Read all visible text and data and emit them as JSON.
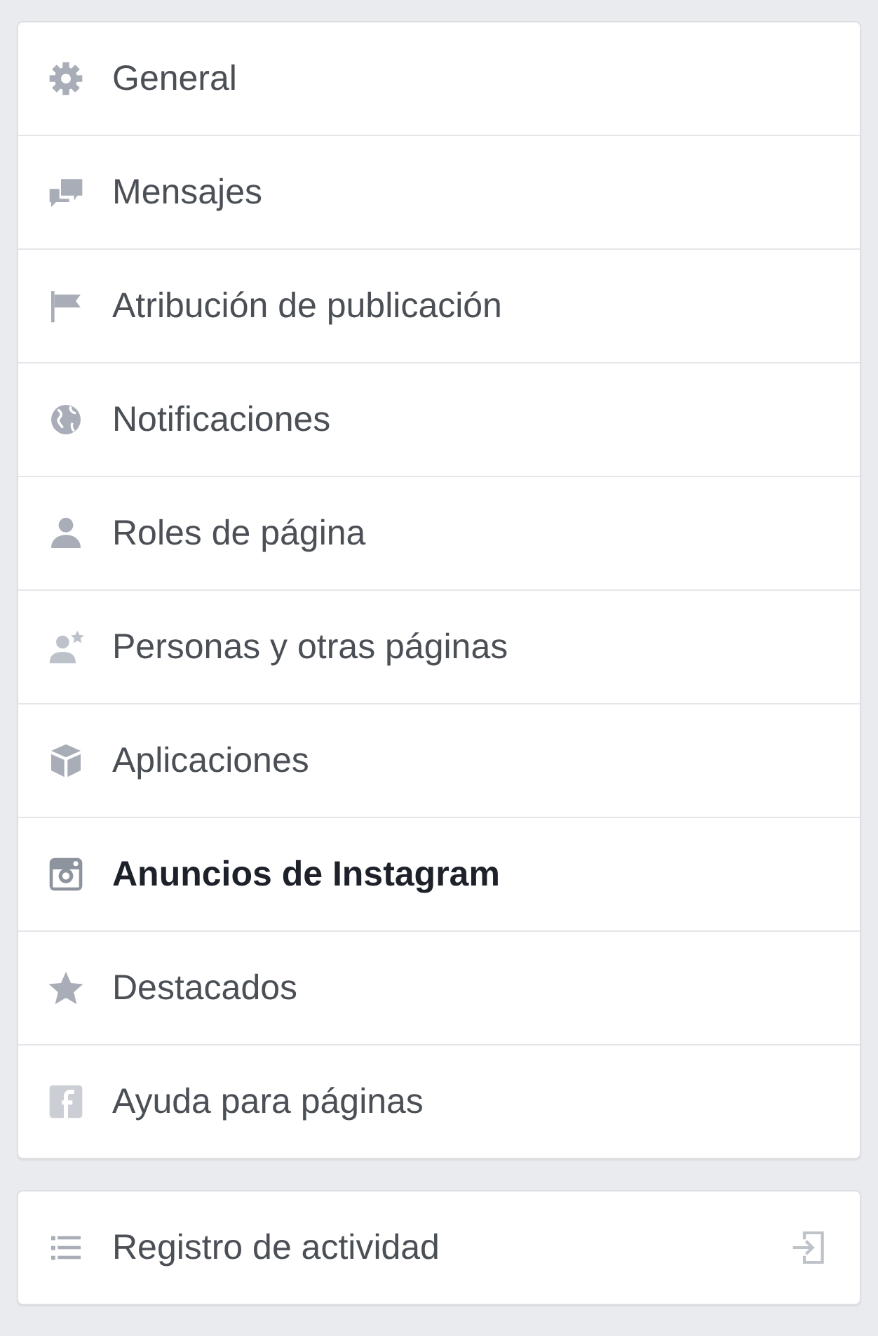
{
  "menu": {
    "items": [
      {
        "label": "General",
        "selected": false
      },
      {
        "label": "Mensajes",
        "selected": false
      },
      {
        "label": "Atribución de publicación",
        "selected": false
      },
      {
        "label": "Notificaciones",
        "selected": false
      },
      {
        "label": "Roles de página",
        "selected": false
      },
      {
        "label": "Personas y otras páginas",
        "selected": false
      },
      {
        "label": "Aplicaciones",
        "selected": false
      },
      {
        "label": "Anuncios de Instagram",
        "selected": true
      },
      {
        "label": "Destacados",
        "selected": false
      },
      {
        "label": "Ayuda para páginas",
        "selected": false
      }
    ]
  },
  "activity_log": {
    "label": "Registro de actividad"
  }
}
